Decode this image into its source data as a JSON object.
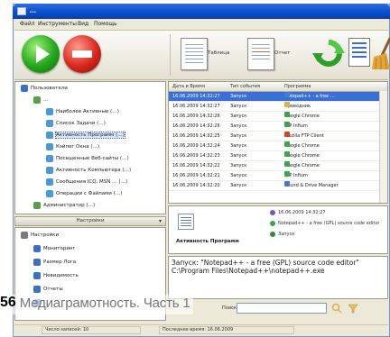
{
  "window": {
    "title": "…",
    "accent": "#0a4cc9"
  },
  "menu": [
    "Файл",
    "Инструменты",
    "Вид",
    "Помощь"
  ],
  "toolbar": {
    "start_icon": "play-icon",
    "stop_icon": "stop-icon",
    "tool1_label": "Таблица",
    "tool2_label": "Отчет",
    "refresh_icon": "refresh-icon",
    "properties_icon": "properties-icon",
    "clean_icon": "broom-icon"
  },
  "tree": [
    {
      "label": "Пользователи",
      "level": 0,
      "color": "#3d6fc9"
    },
    {
      "label": "…",
      "level": 1,
      "color": "#5aa048"
    },
    {
      "label": "Наиболее Активные (…)",
      "level": 2,
      "color": "#4a9ad6"
    },
    {
      "label": "Список Задачи (…)",
      "level": 2,
      "color": "#4a9ad6"
    },
    {
      "label": "Активность Программ (…)",
      "level": 2,
      "color": "#4a9ad6",
      "selected": true
    },
    {
      "label": "Кэйлог Окна (…)",
      "level": 2,
      "color": "#4a9ad6"
    },
    {
      "label": "Посещенные Веб-сайты (…)",
      "level": 2,
      "color": "#4a9ad6"
    },
    {
      "label": "Активность Компьютера (…)",
      "level": 2,
      "color": "#4a9ad6"
    },
    {
      "label": "Сообщения ICQ, MSN … (…)",
      "level": 2,
      "color": "#4a9ad6"
    },
    {
      "label": "Операции с Файлами (…)",
      "level": 2,
      "color": "#4a9ad6"
    },
    {
      "label": "Администратор (…)",
      "level": 1,
      "color": "#5aa048"
    }
  ],
  "settings_header": "Настройки",
  "settings_tree": [
    {
      "label": "Настройки",
      "level": 0,
      "color": "#7a7a7a"
    },
    {
      "label": "Мониторинг",
      "level": 1,
      "color": "#3d6fc9"
    },
    {
      "label": "Размер Лога",
      "level": 1,
      "color": "#3d6fc9"
    },
    {
      "label": "Невидимость",
      "level": 1,
      "color": "#3d6fc9"
    },
    {
      "label": "Отчеты",
      "level": 1,
      "color": "#3d6fc9"
    },
    {
      "label": "…",
      "level": 1,
      "color": "#3d6fc9"
    }
  ],
  "grid": {
    "headers": [
      "Дата и Время",
      "Тип события",
      "Программа"
    ],
    "rows": [
      {
        "time": "16.06.2009 14:32:27",
        "type": "Запуск",
        "program": "Notepad++ - a free …",
        "icon": "#3f7fd9",
        "selected": true
      },
      {
        "time": "16.06.2009 14:32:27",
        "type": "Запуск",
        "program": "Проводник",
        "icon": "#d9b24a"
      },
      {
        "time": "16.06.2009 14:32:26",
        "type": "Запуск",
        "program": "Google Chrome",
        "icon": "#3aa54a"
      },
      {
        "time": "16.06.2009 14:32:26",
        "type": "Запуск",
        "program": "QIP Infium",
        "icon": "#3aa54a"
      },
      {
        "time": "16.06.2009 14:32:25",
        "type": "Запуск",
        "program": "Mozilla FTP Client",
        "icon": "#d8442a"
      },
      {
        "time": "16.06.2009 14:32:24",
        "type": "Запуск",
        "program": "Google Chrome",
        "icon": "#3aa54a"
      },
      {
        "time": "16.06.2009 14:32:23",
        "type": "Запуск",
        "program": "Google Chrome",
        "icon": "#3aa54a"
      },
      {
        "time": "16.06.2009 14:32:22",
        "type": "Запуск",
        "program": "Google Chrome",
        "icon": "#3aa54a"
      },
      {
        "time": "16.06.2009 14:32:21",
        "type": "Запуск",
        "program": "QIP Infium",
        "icon": "#3aa54a"
      },
      {
        "time": "16.06.2009 14:32:20",
        "type": "Запуск",
        "program": "Sound & Drive Manager",
        "icon": "#4a7ad0"
      }
    ]
  },
  "detail": {
    "title": "Активность Программ",
    "time": "16.06.2009 14:32:27",
    "app": "Notepad++ - a free (GPL) source code editor",
    "event": "Запуск",
    "time_color": "#6a5acd",
    "app_color": "#3aa54a",
    "event_color": "#2f8f2f"
  },
  "text_area": {
    "line1": "Запуск: \"Notepad++ - a free (GPL) source code editor\"",
    "line2": "C:\\Program Files\\Notepad++\\notepad++.exe"
  },
  "search": {
    "label": "Поиск",
    "value": "",
    "placeholder": ""
  },
  "status": [
    "Число записей: 10",
    "Последнее время: 16.06.2009"
  ],
  "caption": {
    "number": "56",
    "text": "Медиаграмотность. Часть 1"
  }
}
